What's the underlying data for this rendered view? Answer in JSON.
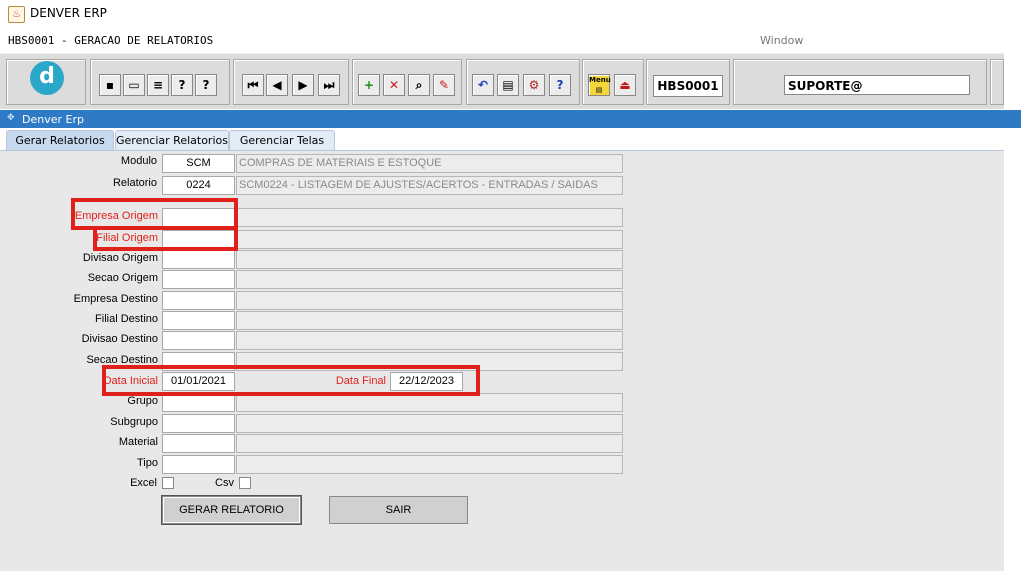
{
  "window": {
    "title": "DENVER ERP"
  },
  "form_bar": {
    "title": "HBS0001 - GERACAO DE RELATORIOS",
    "window_menu": "Window"
  },
  "toolbar": {
    "logo": "d",
    "program_code": "HBS0001",
    "user": "SUPORTE@",
    "icons": [
      "save-icon",
      "window-icon",
      "print-icon",
      "help-query-icon",
      "help-query-alt-icon",
      "first-record-icon",
      "prev-record-icon",
      "next-record-icon",
      "last-record-icon",
      "insert-record-icon",
      "delete-record-icon",
      "query-icon",
      "edit-icon",
      "undo-icon",
      "clipboard-icon",
      "tools-icon",
      "help-icon",
      "menu-icon",
      "exit-icon"
    ]
  },
  "app_header": {
    "title": "Denver Erp"
  },
  "tabs": [
    {
      "label": "Gerar Relatorios",
      "active": true
    },
    {
      "label": "Gerenciar Relatorios",
      "active": false
    },
    {
      "label": "Gerenciar Telas",
      "active": false
    }
  ],
  "form": {
    "modulo": {
      "label": "Modulo",
      "code": "SCM",
      "desc": "COMPRAS DE MATERIAIS E ESTOQUE"
    },
    "relatorio": {
      "label": "Relatorio",
      "code": "0224",
      "desc": "SCM0224 - LISTAGEM DE AJUSTES/ACERTOS - ENTRADAS / SAIDAS"
    },
    "fields": [
      {
        "label": "Empresa Origem",
        "required": true
      },
      {
        "label": "Filial Origem",
        "required": true
      },
      {
        "label": "Divisao Origem",
        "required": false
      },
      {
        "label": "Secao Origem",
        "required": false
      },
      {
        "label": "Empresa Destino",
        "required": false
      },
      {
        "label": "Filial Destino",
        "required": false
      },
      {
        "label": "Divisao Destino",
        "required": false
      },
      {
        "label": "Secao Destino",
        "required": false
      }
    ],
    "data_inicial": {
      "label": "Data Inicial",
      "value": "01/01/2021"
    },
    "data_final": {
      "label": "Data Final",
      "value": "22/12/2023"
    },
    "extra_fields": [
      {
        "label": "Grupo"
      },
      {
        "label": "Subgrupo"
      },
      {
        "label": "Material"
      },
      {
        "label": "Tipo"
      }
    ],
    "excel_label": "Excel",
    "csv_label": "Csv",
    "generate_button": "GERAR RELATORIO",
    "exit_button": "SAIR"
  },
  "colors": {
    "required_label": "#e0201b",
    "highlight_box": "#e0201b",
    "app_header": "#2e7ac5"
  }
}
